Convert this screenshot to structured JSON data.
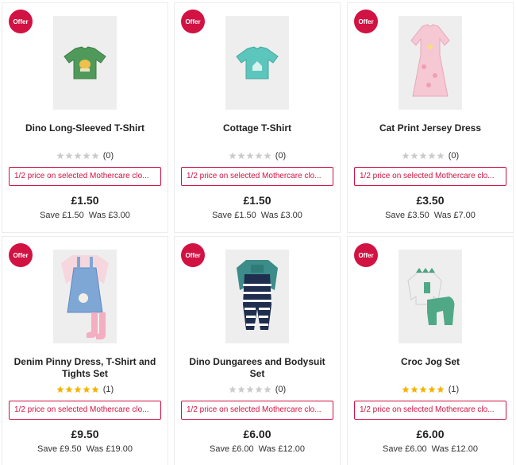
{
  "colors": {
    "offer": "#d11242",
    "star_filled": "#f5b400",
    "star_empty": "#cccccc"
  },
  "products": [
    {
      "badge": "Offer",
      "image": "green-dino-longsleeve-tshirt",
      "title": "Dino Long-Sleeved T-Shirt",
      "stars_filled": 0,
      "review_count": "(0)",
      "promo": "1/2 price on selected Mothercare clo...",
      "price": "£1.50",
      "save": "Save £1.50",
      "was": "Was £3.00"
    },
    {
      "badge": "Offer",
      "image": "teal-cottage-tshirt",
      "title": "Cottage T-Shirt",
      "stars_filled": 0,
      "review_count": "(0)",
      "promo": "1/2 price on selected Mothercare clo...",
      "price": "£1.50",
      "save": "Save £1.50",
      "was": "Was £3.00"
    },
    {
      "badge": "Offer",
      "image": "pink-cat-print-dress",
      "title": "Cat Print Jersey Dress",
      "stars_filled": 0,
      "review_count": "(0)",
      "promo": "1/2 price on selected Mothercare clo...",
      "price": "£3.50",
      "save": "Save £3.50",
      "was": "Was £7.00"
    },
    {
      "badge": "Offer",
      "image": "denim-pinny-dress-set",
      "title": "Denim Pinny Dress, T-Shirt and Tights Set",
      "stars_filled": 5,
      "review_count": "(1)",
      "promo": "1/2 price on selected Mothercare clo...",
      "price": "£9.50",
      "save": "Save £9.50",
      "was": "Was £19.00"
    },
    {
      "badge": "Offer",
      "image": "navy-striped-dungarees",
      "title": "Dino Dungarees and Bodysuit Set",
      "stars_filled": 0,
      "review_count": "(0)",
      "promo": "1/2 price on selected Mothercare clo...",
      "price": "£6.00",
      "save": "Save £6.00",
      "was": "Was £12.00"
    },
    {
      "badge": "Offer",
      "image": "green-croc-jog-set",
      "title": "Croc Jog Set",
      "stars_filled": 5,
      "review_count": "(1)",
      "promo": "1/2 price on selected Mothercare clo...",
      "price": "£6.00",
      "save": "Save £6.00",
      "was": "Was £12.00"
    }
  ]
}
